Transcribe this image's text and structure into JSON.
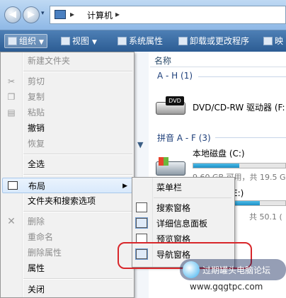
{
  "address": {
    "location": "计算机",
    "separator": "▸"
  },
  "toolbar": {
    "organize": "组织",
    "view": "视图",
    "system_properties": "系统属性",
    "uninstall": "卸载或更改程序",
    "map": "映"
  },
  "columns": {
    "name": "名称"
  },
  "groups": {
    "ah": "A - H (1)",
    "pinyin": "拼音 A - F (3)"
  },
  "drives": {
    "dvd": {
      "name": "DVD/CD-RW 驱动器 (F:",
      "icon_text": "DVD"
    },
    "c": {
      "name": "本地磁盘 (C:)",
      "free": "9.60 GB 可用，共 19.5 G",
      "fill": 0.5
    },
    "d": {
      "name_tail": "E:)",
      "free": "共 50.1 (",
      "fill": 0.72
    }
  },
  "menu": {
    "new_folder": "新建文件夹",
    "cut": "剪切",
    "copy": "复制",
    "paste": "粘贴",
    "undo": "撤销",
    "redo": "恢复",
    "select_all": "全选",
    "layout": "布局",
    "folder_options": "文件夹和搜索选项",
    "delete": "删除",
    "rename": "重命名",
    "remove_properties": "删除属性",
    "properties": "属性",
    "close": "关闭"
  },
  "submenu": {
    "menu_bar": "菜单栏",
    "search_pane": "搜索窗格",
    "details_pane": "详细信息面板",
    "preview_pane": "预览窗格",
    "navigation_pane": "导航窗格"
  },
  "watermark": {
    "line1": "过期罐头电脑论坛",
    "line2": "www.gqgtpc.com"
  },
  "colors": {
    "highlight": "#d9e9fb",
    "annotation": "#d8262a",
    "toolbar": "#2c5c93"
  }
}
